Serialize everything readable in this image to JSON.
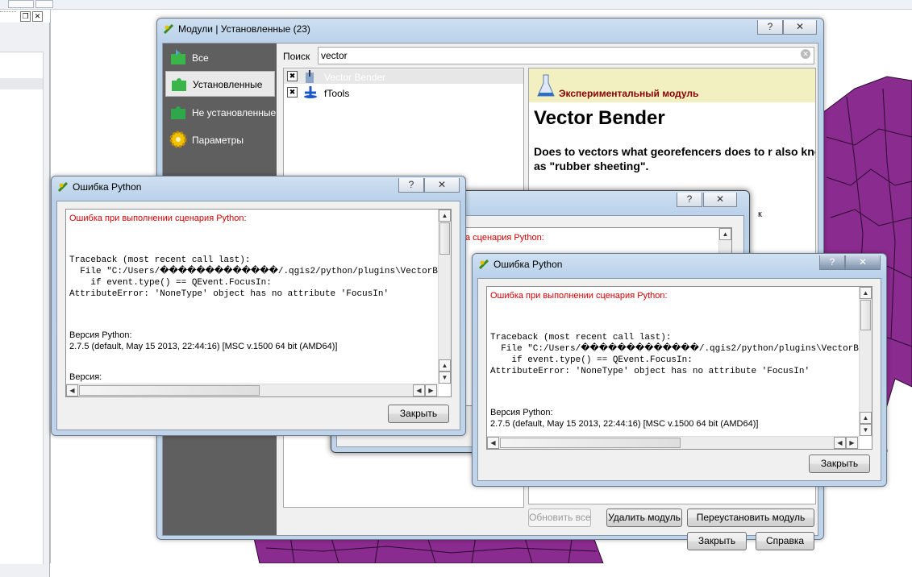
{
  "plugin_manager": {
    "title": "Модули | Установленные (23)",
    "help_label": "?",
    "close_label": "✕",
    "sidebar": [
      {
        "label": "Все",
        "icon": "puzzle-all-icon"
      },
      {
        "label": "Установленные",
        "icon": "puzzle-installed-icon"
      },
      {
        "label": "Не установленные",
        "icon": "puzzle-not-installed-icon"
      },
      {
        "label": "Параметры",
        "icon": "gear-icon"
      }
    ],
    "search_label": "Поиск",
    "search_value": "vector",
    "plugins": [
      {
        "name": "Vector Bender",
        "checked_mark": "✖",
        "selected": true
      },
      {
        "name": "fTools",
        "checked_mark": "✖",
        "selected": false
      }
    ],
    "details": {
      "experimental_label": "Экспериментальный модуль",
      "name": "Vector Bender",
      "description": "Does to vectors what georefencers does to r also known as \"rubber sheeting\"."
    },
    "buttons": {
      "update_all": "Обновить все",
      "remove": "Удалить модуль",
      "reinstall": "Переустановить модуль",
      "close": "Закрыть",
      "help": "Справка"
    }
  },
  "error_dialog_1": {
    "title": "Ошибка Python",
    "error_heading": "Ошибка при выполнении сценария Python:",
    "traceback": "Traceback (most recent call last):\n  File \"C:/Users/�������������/.qgis2/python/plugins\\VectorB\n    if event.type() == QEvent.FocusIn:\nAttributeError: 'NoneType' object has no attribute 'FocusIn'",
    "python_version_label": "Версия Python:",
    "python_version": "2.7.5 (default, May 15 2013, 22:44:16) [MSC v.1500 64 bit (AMD64)]",
    "version_label": "Версия:",
    "close_button": "Закрыть"
  },
  "error_dialog_middle": {
    "fragment_error": "а сценария Python:",
    "fragment_k": "к"
  },
  "error_dialog_2": {
    "title": "Ошибка Python",
    "error_heading": "Ошибка при выполнении сценария Python:",
    "traceback": "Traceback (most recent call last):\n  File \"C:/Users/�������������/.qgis2/python/plugins\\VectorB\n    if event.type() == QEvent.FocusIn:\nAttributeError: 'NoneType' object has no attribute 'FocusIn'",
    "python_version_label": "Версия Python:",
    "python_version": "2.7.5 (default, May 15 2013, 22:44:16) [MSC v.1500 64 bit (AMD64)]",
    "close_button": "Закрыть"
  },
  "colors": {
    "map_fill": "#8a2b8f",
    "sidebar_bg": "#5f5f5f",
    "experimental_bg": "#f2f0c0",
    "error_red": "#d40000"
  }
}
